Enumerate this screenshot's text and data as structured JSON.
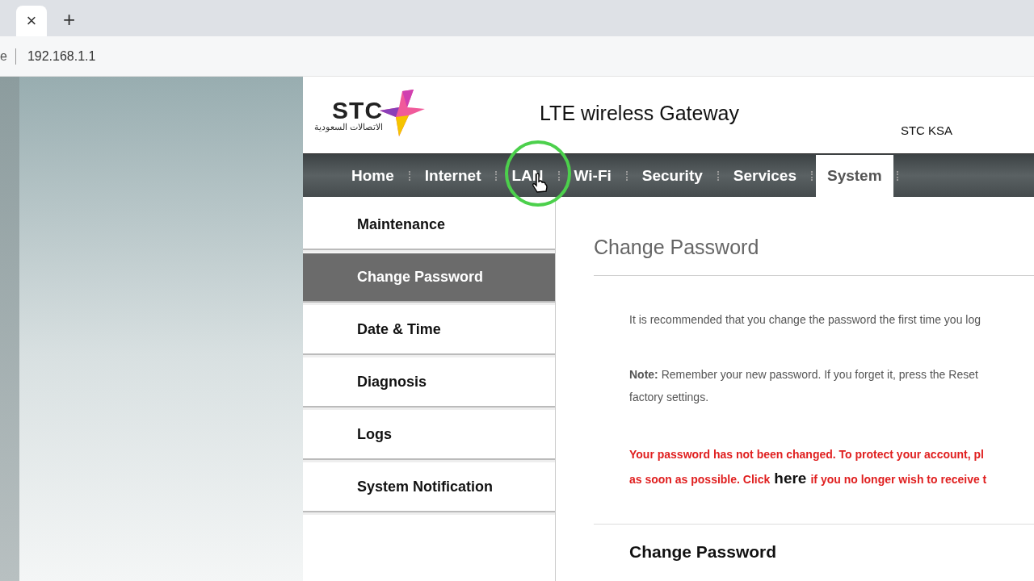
{
  "browser": {
    "tab_close": "×",
    "new_tab": "+",
    "address_prefix": "e",
    "address": "192.168.1.1"
  },
  "header": {
    "logo_text": "STC",
    "logo_subtext": "الاتصالات السعودية",
    "title": "LTE wireless Gateway",
    "region": "STC KSA"
  },
  "nav": [
    {
      "label": "Home",
      "selected": false
    },
    {
      "label": "Internet",
      "selected": false
    },
    {
      "label": "LAN",
      "selected": false
    },
    {
      "label": "Wi-Fi",
      "selected": false
    },
    {
      "label": "Security",
      "selected": false
    },
    {
      "label": "Services",
      "selected": false
    },
    {
      "label": "System",
      "selected": true
    }
  ],
  "sidebar": [
    {
      "label": "Maintenance",
      "selected": false
    },
    {
      "label": "Change Password",
      "selected": true
    },
    {
      "label": "Date & Time",
      "selected": false
    },
    {
      "label": "Diagnosis",
      "selected": false
    },
    {
      "label": "Logs",
      "selected": false
    },
    {
      "label": "System Notification",
      "selected": false
    }
  ],
  "content": {
    "heading": "Change Password",
    "paragraphs": [
      {
        "kind": "info",
        "lines": [
          "It is recommended that you change the password the first time you log"
        ]
      },
      {
        "kind": "info",
        "lines": [
          "**Note:** Remember your new password. If you forget it, press the Reset",
          "factory settings."
        ]
      },
      {
        "kind": "warning",
        "lines": [
          "Your password has not been changed. To protect your account, pl"
        ],
        "last_line": {
          "before": "as soon as possible. Click",
          "link": "here",
          "after": "if you no longer wish to receive t"
        }
      }
    ],
    "section_title": "Change Password"
  }
}
